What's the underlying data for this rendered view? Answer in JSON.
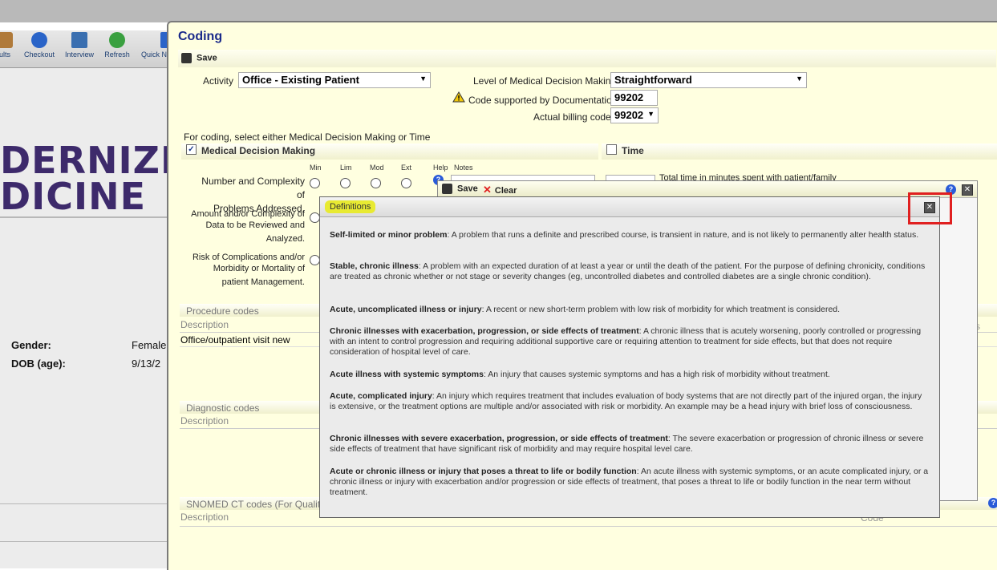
{
  "toolbar": {
    "buttons": [
      {
        "label": "ults",
        "icon": "results-icon"
      },
      {
        "label": "Checkout",
        "icon": "checkout-icon"
      },
      {
        "label": "Interview",
        "icon": "interview-icon"
      },
      {
        "label": "Refresh",
        "icon": "refresh-icon"
      },
      {
        "label": "Quick N",
        "icon": "quick-note-icon"
      }
    ]
  },
  "left": {
    "logo_line1": "DERNIZI",
    "logo_line2": "DICINE",
    "gender_label": "Gender:",
    "gender_value": "Female",
    "dob_label": "DOB (age):",
    "dob_value": "9/13/2"
  },
  "coding": {
    "title": "Coding",
    "save_label": "Save",
    "activity_label": "Activity",
    "activity_value": "Office - Existing Patient",
    "mdm_level_label": "Level of Medical Decision Making",
    "mdm_level_value": "Straightforward",
    "code_supported_label": "Code supported by Documentation",
    "code_supported_value": "99202",
    "billing_label": "Actual billing code",
    "billing_value": "99202",
    "coding_hint": "For coding, select either Medical Decision Making or Time",
    "mdm_section": "Medical Decision Making",
    "time_section": "Time",
    "col_min": "Min",
    "col_lim": "Lim",
    "col_mod": "Mod",
    "col_ext": "Ext",
    "col_help": "Help",
    "col_notes": "Notes",
    "row1_line1": "Number and Complexity of",
    "row1_line2": "Problems Addressed.",
    "row2_line1": "Amount and/or Complexity of",
    "row2_line2": "Data to be Reviewed and",
    "row2_line3": "Analyzed.",
    "row3_line1": "Risk of Complications and/or",
    "row3_line2": "Morbidity or Mortality of",
    "row3_line3": "patient Management.",
    "time_text": "Total time in minutes spent with patient/family",
    "procedure_section": "Procedure codes",
    "procedure_desc_hdr": "Description",
    "procedure_row": "Office/outpatient visit new",
    "diagnostic_section": "Diagnostic codes",
    "diagnostic_desc_hdr": "Description",
    "snomed_section": "SNOMED CT codes (For Quality",
    "snomed_desc_hdr": "Description",
    "snomed_code_hdr": "Code",
    "right_partial": "rs"
  },
  "dialog2": {
    "save_label": "Save",
    "clear_label": "Clear"
  },
  "definitions": {
    "title": "Definitions",
    "items": [
      {
        "term": "Self-limited or minor problem",
        "text": ": A problem that runs a definite and prescribed course, is transient in nature, and is not likely to permanently alter health status."
      },
      {
        "term": "Stable, chronic illness",
        "text": ": A problem with an expected duration of at least a year or until the death of the patient. For the purpose of defining chronicity, conditions are treated as chronic whether or not stage or severity changes (eg, uncontrolled diabetes and controlled diabetes are a single chronic condition)."
      },
      {
        "term": "Acute, uncomplicated illness or injury",
        "text": ": A recent or new short-term problem with low risk of morbidity for which treatment is considered."
      },
      {
        "term": "Chronic illnesses with exacerbation, progression, or side effects of treatment",
        "text": ": A chronic illness that is acutely worsening, poorly controlled or progressing with an intent to control progression and requiring additional supportive care or requiring attention to treatment for side effects, but that does not require consideration of hospital level of care."
      },
      {
        "term": "Acute illness with systemic symptoms",
        "text": ": An injury that causes systemic symptoms and has a high risk of morbidity without treatment."
      },
      {
        "term": "Acute, complicated injury",
        "text": ": An injury which requires treatment that includes evaluation of body systems that are not directly part of the injured organ, the injury is extensive, or the treatment options are multiple and/or associated with risk or morbidity. An example may be a head injury with brief loss of consciousness."
      },
      {
        "term": "Chronic illnesses with severe exacerbation, progression, or side effects of treatment",
        "text": ": The severe exacerbation or progression of chronic illness or severe side effects of treatment that have significant risk of morbidity and may require hospital level care."
      },
      {
        "term": "Acute or chronic illness or injury that poses a threat to life or bodily function",
        "text": ": An acute illness with systemic symptoms, or an acute complicated injury, or a chronic illness or injury with exacerbation and/or progression or side effects of treatment, that poses a threat to life or bodily function in the near term without treatment."
      }
    ]
  },
  "colors": {
    "accent_title": "#1a2a8a",
    "highlight": "#e8ea32",
    "callout_red": "#e02020",
    "window_bg": "#ffffe0"
  }
}
